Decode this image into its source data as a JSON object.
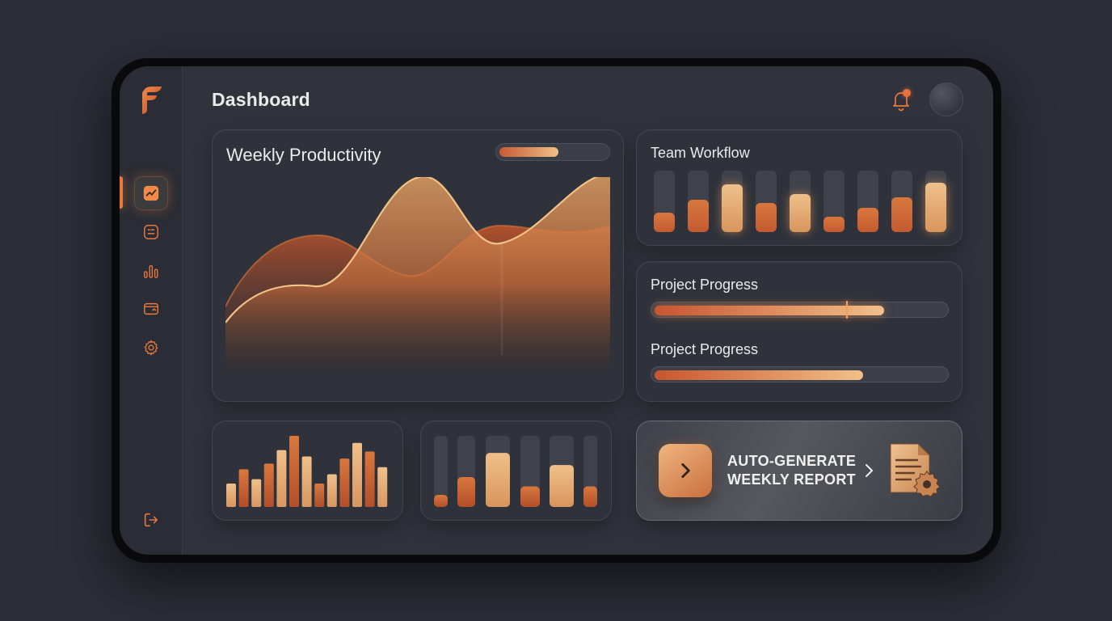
{
  "header": {
    "title": "Dashboard"
  },
  "sidebar": {
    "items": [
      {
        "icon": "trend-chart-icon",
        "active": true
      },
      {
        "icon": "list-icon",
        "active": false
      },
      {
        "icon": "bar-chart-icon",
        "active": false
      },
      {
        "icon": "wallet-icon",
        "active": false
      },
      {
        "icon": "gear-icon",
        "active": false
      }
    ],
    "logout_icon": "logout-icon"
  },
  "productivity": {
    "title": "Weekly Productivity",
    "slider_level": 0.55
  },
  "workflow": {
    "title": "Team Workflow",
    "levels": [
      0.32,
      0.53,
      0.78,
      0.47,
      0.62,
      0.25,
      0.39,
      0.57,
      0.8
    ],
    "highlighted": [
      false,
      false,
      true,
      false,
      true,
      false,
      false,
      false,
      true
    ]
  },
  "progress": {
    "items": [
      {
        "label": "Project Progress",
        "value": 0.79,
        "marker": 0.67
      },
      {
        "label": "Project Progress",
        "value": 0.72
      }
    ]
  },
  "mini_chart_1": {
    "levels": [
      0.33,
      0.53,
      0.39,
      0.61,
      0.8,
      1.0,
      0.71,
      0.33,
      0.46,
      0.68,
      0.9,
      0.78,
      0.56
    ]
  },
  "mini_chart_2": {
    "levels": [
      0.17,
      0.42,
      0.76,
      0.29,
      0.59,
      0.29
    ],
    "highlighted": [
      false,
      false,
      true,
      false,
      true,
      false
    ]
  },
  "report": {
    "line1": "AUTO-GENERATE",
    "line2": "WEEKLY REPORT"
  },
  "colors": {
    "accent": "#e8783c",
    "bar_dark": "#c45a30",
    "bar_light": "#eec08c",
    "background": "#2b2e37",
    "card": "#2f323b"
  }
}
